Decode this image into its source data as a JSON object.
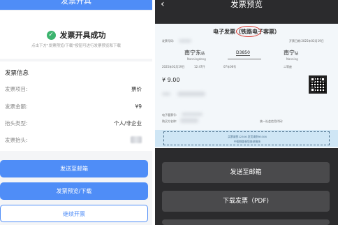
{
  "left": {
    "header_title": "发票开具",
    "success": {
      "title": "发票开具成功",
      "subtitle": "点击下方\"发票预览/下载\"按钮可进行发票预览和下载"
    },
    "info": {
      "section_title": "发票信息",
      "rows": [
        {
          "key": "发票项目:",
          "value": "票价"
        },
        {
          "key": "发票金额:",
          "value": "¥9"
        },
        {
          "key": "抬头类型:",
          "value": "个人/非企业"
        },
        {
          "key": "发票抬头:",
          "value": ""
        }
      ]
    },
    "buttons": {
      "send_email": "发送至邮箱",
      "preview_download": "发票预览/下载",
      "continue": "继续开票"
    },
    "accent_color": "#4f8df7"
  },
  "right": {
    "title": "发票预览",
    "invoice": {
      "title": "电子发票（铁路电子客票）",
      "invoice_no_label": "发票号码:",
      "date_label": "开票日期:2025年02月19日",
      "from_station": "南宁东",
      "from_suffix": "站",
      "from_pinyin": "Nanningdong",
      "train_no": "D3850",
      "to_station": "南宁",
      "to_suffix": "站",
      "to_pinyin": "Nanning",
      "depart_date": "2025年02月19日",
      "depart_time": "12:47开",
      "seat": "07车06号",
      "seat_class": "二等座",
      "price": "¥ 9.00",
      "ticket_no_label": "电子客票号:",
      "buyer_label": "购买方名称:",
      "credit_label": "统一社会信用代码:",
      "notice_line1": "买票请到12306 发货请到95306",
      "notice_line2": "中国铁路祝您旅途愉快"
    },
    "buttons": {
      "send_email": "发送至邮箱",
      "download_pdf": "下载发票（PDF)"
    },
    "accent_color": "#d9362c"
  }
}
